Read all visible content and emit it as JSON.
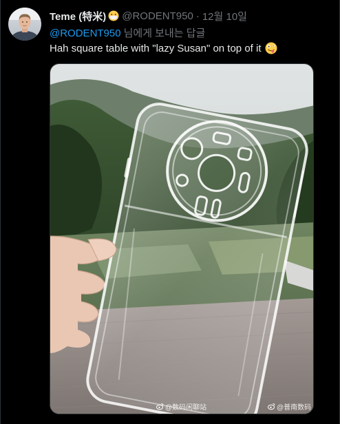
{
  "tweet": {
    "display_name": "Teme (特米)",
    "name_emoji": "mask-face-emoji",
    "handle": "@RODENT950",
    "separator": "·",
    "date": "12월 10일",
    "reply_to": "@RODENT950",
    "reply_suffix": "님에게 보내는 답글",
    "text": "Hah square table with \"lazy Susan\" on top of it",
    "text_emoji": "zany-face-emoji"
  },
  "media": {
    "description_icon": "photo",
    "watermarks": {
      "left": "@数码闲聊站",
      "right": "@普南数码"
    }
  },
  "colors": {
    "background": "#000000",
    "text_primary": "#e7e9ea",
    "text_secondary": "#71767b",
    "link": "#1d9bf0",
    "border": "#2f3336"
  }
}
